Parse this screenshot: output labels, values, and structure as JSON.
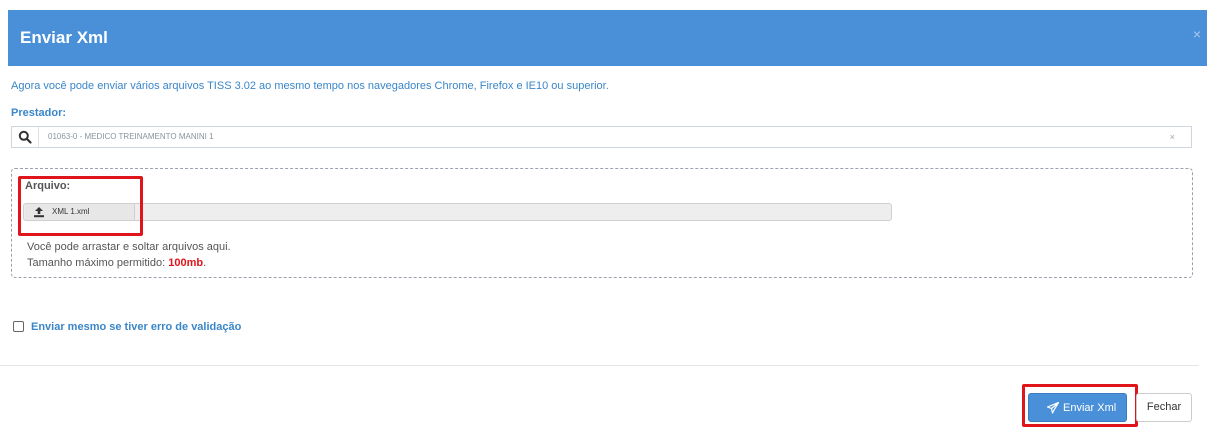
{
  "modal": {
    "title": "Enviar Xml",
    "close_glyph": "×",
    "info_text": "Agora você pode enviar vários arquivos TISS 3.02 ao mesmo tempo nos navegadores Chrome, Firefox e IE10 ou superior.",
    "prestador": {
      "label": "Prestador:",
      "value": "01063-0 - MEDICO TREINAMENTO MANINI 1",
      "clear_glyph": "×",
      "icon": "search-icon"
    },
    "dropzone": {
      "label": "Arquivo:",
      "file_name": "XML 1.xml",
      "file_icon": "upload-icon",
      "hint_line1": "Você pode arrastar e soltar arquivos aqui.",
      "hint_line2_prefix": "Tamanho máximo permitido: ",
      "max_size": "100mb",
      "hint_line2_suffix": "."
    },
    "checkbox": {
      "label": "Enviar mesmo se tiver erro de validação",
      "checked": false
    },
    "footer": {
      "send_label": "Enviar Xml",
      "send_icon": "paper-plane-icon",
      "close_label": "Fechar"
    }
  },
  "colors": {
    "header_bg": "#4a90d9",
    "accent_text": "#3a86c8",
    "highlight_red": "#e0151b"
  }
}
